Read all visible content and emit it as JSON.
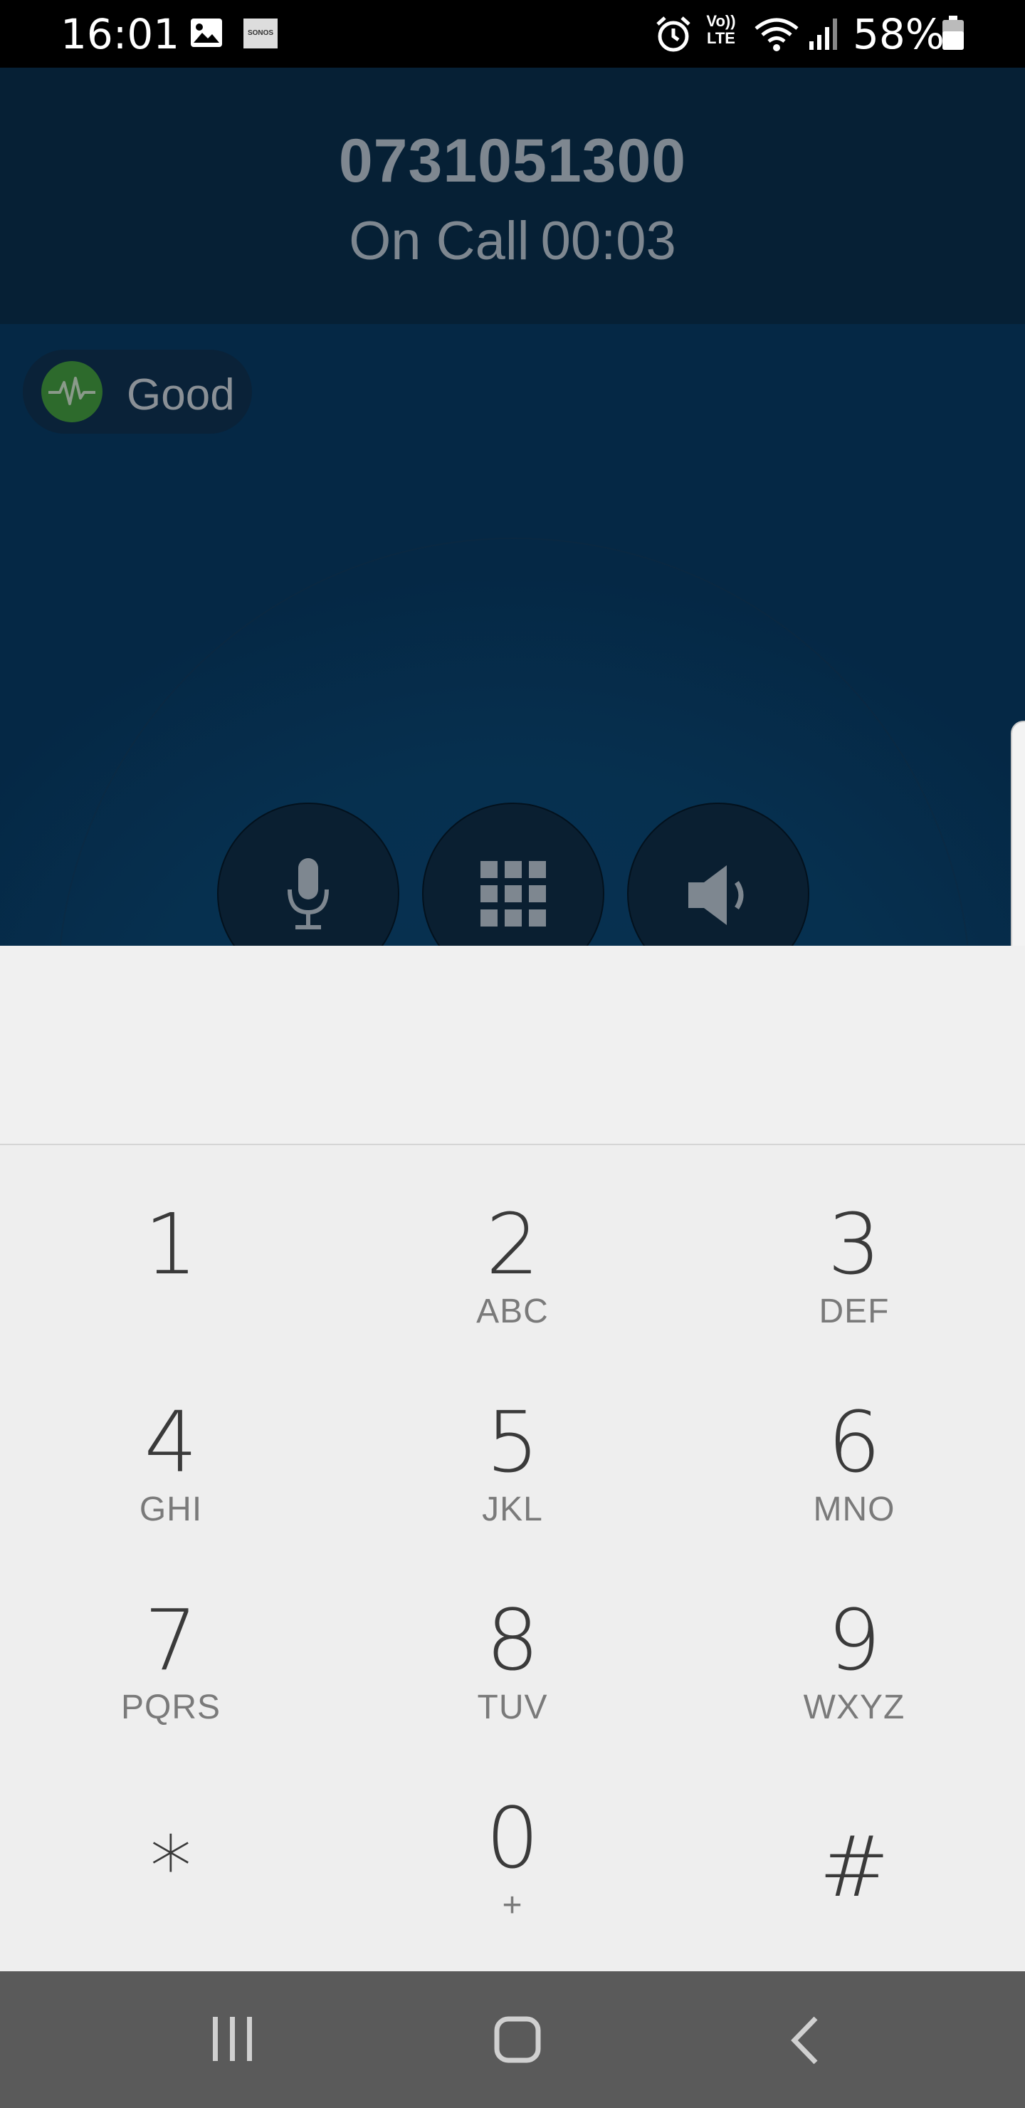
{
  "status_bar": {
    "time": "16:01",
    "battery_percent": "58%",
    "network_label": "Vo)) LTE",
    "sonos_label": "SONOS",
    "icons": [
      "gallery-icon",
      "sonos-icon",
      "alarm-icon",
      "volte-icon",
      "wifi-icon",
      "signal-icon",
      "battery-icon"
    ]
  },
  "call": {
    "number": "0731051300",
    "status": "On Call",
    "duration": "00:03"
  },
  "quality": {
    "label": "Good",
    "icon": "pulse-icon",
    "color": "#2d6a2c"
  },
  "controls": [
    {
      "name": "mute",
      "icon": "microphone-icon"
    },
    {
      "name": "keypad",
      "icon": "keypad-icon"
    },
    {
      "name": "speaker",
      "icon": "speaker-icon"
    }
  ],
  "dialpad": {
    "keys": [
      {
        "digit": "1",
        "letters": ""
      },
      {
        "digit": "2",
        "letters": "ABC"
      },
      {
        "digit": "3",
        "letters": "DEF"
      },
      {
        "digit": "4",
        "letters": "GHI"
      },
      {
        "digit": "5",
        "letters": "JKL"
      },
      {
        "digit": "6",
        "letters": "MNO"
      },
      {
        "digit": "7",
        "letters": "PQRS"
      },
      {
        "digit": "8",
        "letters": "TUV"
      },
      {
        "digit": "9",
        "letters": "WXYZ"
      },
      {
        "digit": "*",
        "letters": ""
      },
      {
        "digit": "0",
        "letters": "+"
      },
      {
        "digit": "#",
        "letters": ""
      }
    ]
  },
  "nav": {
    "icons": [
      "recent-apps-icon",
      "home-icon",
      "back-icon"
    ]
  },
  "colors": {
    "header_bg": "#062035",
    "call_bg": "#073150",
    "dialpad_bg": "#eeeeee",
    "nav_bg": "#5a5a5a"
  }
}
